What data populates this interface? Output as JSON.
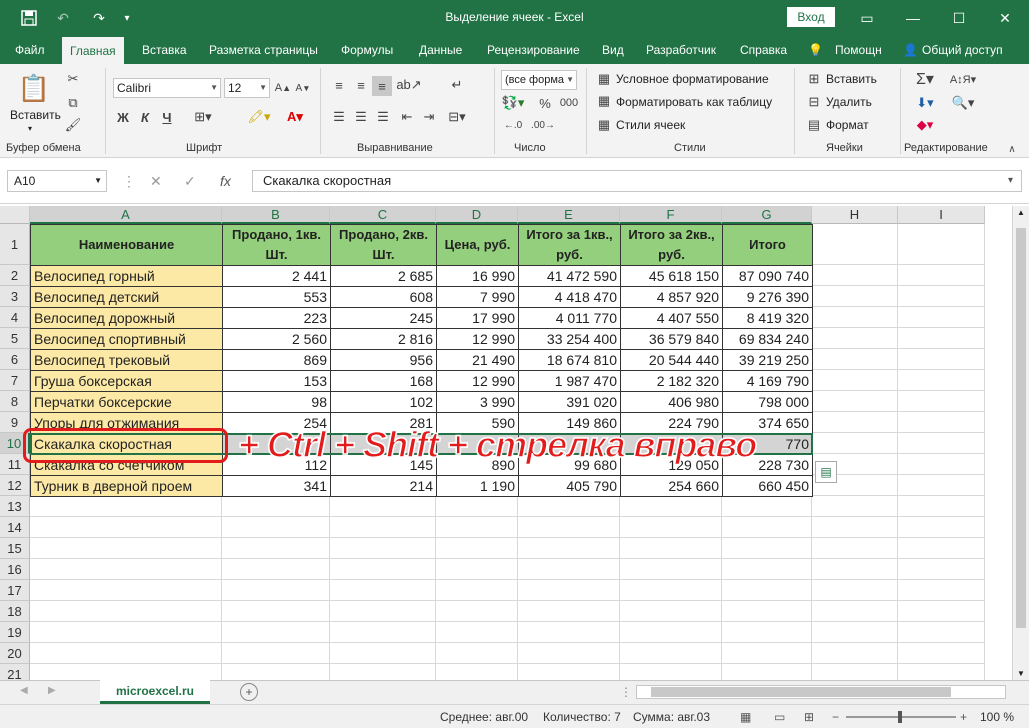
{
  "titlebar": {
    "title": "Выделение ячеек - Excel",
    "signin": "Вход",
    "save_icon": "save-icon",
    "undo_icon": "undo-icon",
    "redo_icon": "redo-icon"
  },
  "tabs": [
    "Файл",
    "Главная",
    "Вставка",
    "Разметка страницы",
    "Формулы",
    "Данные",
    "Рецензирование",
    "Вид",
    "Разработчик",
    "Справка",
    "Помощн",
    "Общий доступ"
  ],
  "ribbon": {
    "paste_label": "Вставить",
    "clipboard_label": "Буфер обмена",
    "font_name": "Calibri",
    "font_size": "12",
    "font_label": "Шрифт",
    "bold": "Ж",
    "italic": "К",
    "underline": "Ч",
    "align_label": "Выравнивание",
    "number_format": "(все форма",
    "number_label": "Число",
    "cond_format": "Условное форматирование",
    "format_table": "Форматировать как таблицу",
    "cell_styles": "Стили ячеек",
    "styles_label": "Стили",
    "insert": "Вставить",
    "delete": "Удалить",
    "format": "Формат",
    "cells_label": "Ячейки",
    "edit_label": "Редактирование"
  },
  "formula_bar": {
    "name_box": "A10",
    "fx": "fx",
    "value": "Скакалка скоростная"
  },
  "columns": [
    "A",
    "B",
    "C",
    "D",
    "E",
    "F",
    "G",
    "H",
    "I"
  ],
  "header_row": [
    "Наименование",
    "Продано, 1кв. Шт.",
    "Продано, 2кв. Шт.",
    "Цена, руб.",
    "Итого за 1кв., руб.",
    "Итого за 2кв., руб.",
    "Итого"
  ],
  "rows": [
    [
      "Велосипед горный",
      "2 441",
      "2 685",
      "16 990",
      "41 472 590",
      "45 618 150",
      "87 090 740"
    ],
    [
      "Велосипед детский",
      "553",
      "608",
      "7 990",
      "4 418 470",
      "4 857 920",
      "9 276 390"
    ],
    [
      "Велосипед дорожный",
      "223",
      "245",
      "17 990",
      "4 011 770",
      "4 407 550",
      "8 419 320"
    ],
    [
      "Велосипед спортивный",
      "2 560",
      "2 816",
      "12 990",
      "33 254 400",
      "36 579 840",
      "69 834 240"
    ],
    [
      "Велосипед трековый",
      "869",
      "956",
      "21 490",
      "18 674 810",
      "20 544 440",
      "39 219 250"
    ],
    [
      "Груша боксерская",
      "153",
      "168",
      "12 990",
      "1 987 470",
      "2 182 320",
      "4 169 790"
    ],
    [
      "Перчатки боксерские",
      "98",
      "102",
      "3 990",
      "391 020",
      "406 980",
      "798 000"
    ],
    [
      "Упоры для отжимания",
      "254",
      "281",
      "590",
      "149 860",
      "224 790",
      "374 650"
    ],
    [
      "Скакалка скоростная",
      "",
      "",
      "",
      "",
      "",
      "770"
    ],
    [
      "Скакалка со счетчиком",
      "112",
      "145",
      "890",
      "99 680",
      "129 050",
      "228 730"
    ],
    [
      "Турник в дверной проем",
      "341",
      "214",
      "1 190",
      "405 790",
      "254 660",
      "660 450"
    ]
  ],
  "row_numbers": [
    "1",
    "2",
    "3",
    "4",
    "5",
    "6",
    "7",
    "8",
    "9",
    "10",
    "11",
    "12",
    "13",
    "14",
    "15",
    "16",
    "17",
    "18",
    "19",
    "20",
    "21"
  ],
  "overlay_text": "+ Ctrl + Shift + стрелка вправо",
  "sheet_tab": "microexcel.ru",
  "status": {
    "average": "Среднее: авг.00",
    "count": "Количество: 7",
    "sum": "Сумма: авг.03",
    "zoom": "100 %"
  }
}
